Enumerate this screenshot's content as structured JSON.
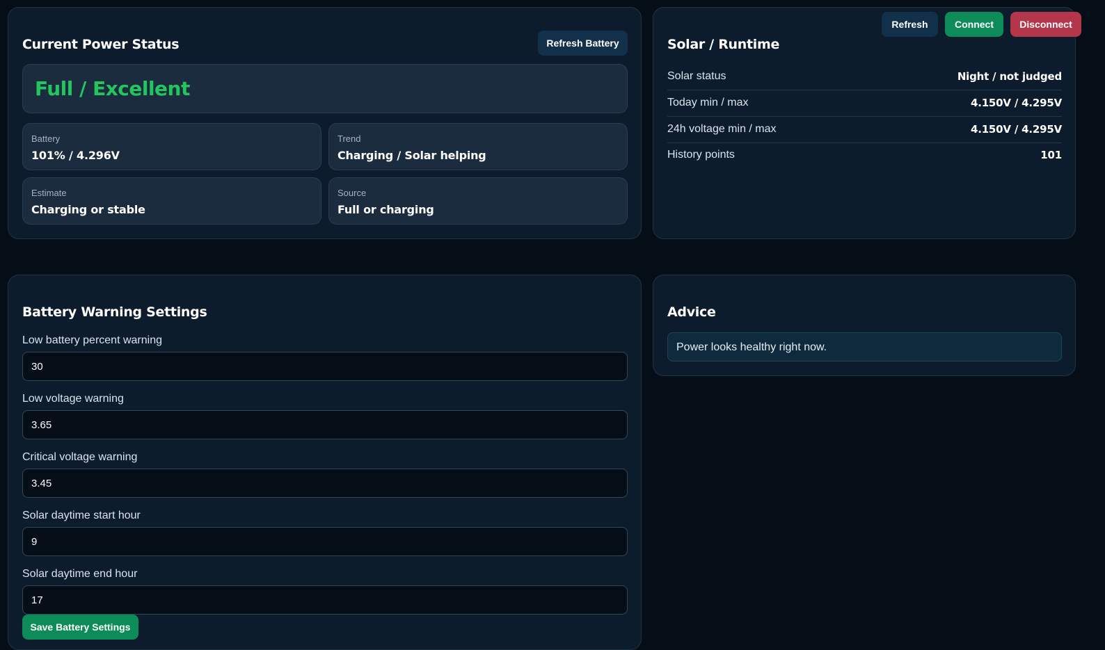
{
  "header": {
    "refresh_label": "Refresh",
    "connect_label": "Connect",
    "disconnect_label": "Disconnect"
  },
  "power": {
    "title": "Current Power Status",
    "refresh_battery_label": "Refresh Battery",
    "status": "Full / Excellent",
    "status_color": "#22c55e",
    "cards": [
      {
        "label": "Battery",
        "value": "101% / 4.296V"
      },
      {
        "label": "Trend",
        "value": "Charging / Solar helping"
      },
      {
        "label": "Estimate",
        "value": "Charging or stable"
      },
      {
        "label": "Source",
        "value": "Full or charging"
      }
    ]
  },
  "solar": {
    "title": "Solar / Runtime",
    "rows": [
      {
        "label": "Solar status",
        "value": "Night / not judged"
      },
      {
        "label": "Today min / max",
        "value": "4.150V / 4.295V"
      },
      {
        "label": "24h voltage min / max",
        "value": "4.150V / 4.295V"
      },
      {
        "label": "History points",
        "value": "101"
      }
    ]
  },
  "settings": {
    "title": "Battery Warning Settings",
    "fields": [
      {
        "label": "Low battery percent warning",
        "value": "30"
      },
      {
        "label": "Low voltage warning",
        "value": "3.65"
      },
      {
        "label": "Critical voltage warning",
        "value": "3.45"
      },
      {
        "label": "Solar daytime start hour",
        "value": "9"
      },
      {
        "label": "Solar daytime end hour",
        "value": "17"
      }
    ],
    "save_label": "Save Battery Settings"
  },
  "advice": {
    "title": "Advice",
    "message": "Power looks healthy right now."
  },
  "colors": {
    "background": "#050d16",
    "panel": "#0d1c2c",
    "accent_green": "#0d8c5a",
    "accent_red": "#b3364b",
    "button_dark": "#12304a"
  }
}
